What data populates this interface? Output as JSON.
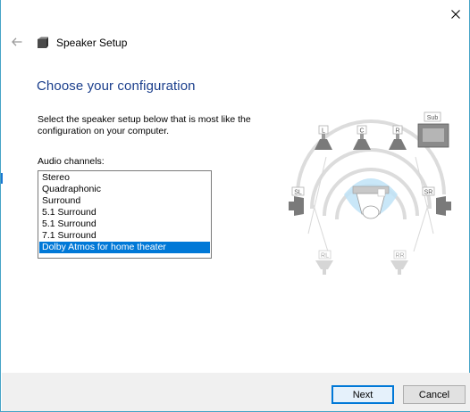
{
  "window": {
    "title": "Speaker Setup",
    "close_icon": "close-icon",
    "back_icon": "back-arrow-icon",
    "title_icon": "speaker-icon"
  },
  "page": {
    "heading": "Choose your configuration",
    "instructions": "Select the speaker setup below that is most like the configuration on your computer.",
    "channels_label": "Audio channels:"
  },
  "audio_channels": {
    "items": [
      {
        "label": "Stereo",
        "selected": false
      },
      {
        "label": "Quadraphonic",
        "selected": false
      },
      {
        "label": "Surround",
        "selected": false
      },
      {
        "label": "5.1 Surround",
        "selected": false
      },
      {
        "label": "5.1 Surround",
        "selected": false
      },
      {
        "label": "7.1 Surround",
        "selected": false
      },
      {
        "label": "Dolby Atmos for home theater",
        "selected": true
      }
    ]
  },
  "diagram": {
    "speakers": {
      "front_left": "L",
      "center": "C",
      "front_right": "R",
      "subwoofer": "Sub",
      "side_left": "SL",
      "side_right": "SR",
      "rear_left": "RL",
      "rear_right": "RR"
    },
    "colors": {
      "active_speaker": "#7a7a7a",
      "inactive_speaker": "#d6d6d6",
      "sound_wave": "#bfe3f7",
      "accent": "#0078d7"
    }
  },
  "buttons": {
    "next": "Next",
    "cancel": "Cancel"
  },
  "colors": {
    "heading": "#1a3e8c",
    "border": "#46a4c7",
    "selection": "#0078d7"
  }
}
